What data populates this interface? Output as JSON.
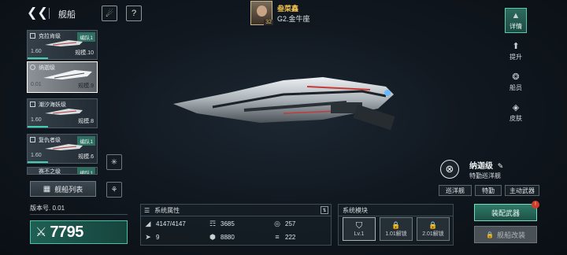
{
  "header": {
    "back_icon": "chevron-left-icon",
    "title": "舰船",
    "icon1": "planet-icon",
    "icon2": "help-icon"
  },
  "player": {
    "name": "叁菜鑫",
    "level": "32",
    "zone": "G2.金牛座"
  },
  "ships": [
    {
      "name": "克拉肯级",
      "fleet": "编队1",
      "value": "1.60",
      "scale": "规模.10",
      "progress": 0.3
    },
    {
      "name": "纳迦级",
      "fleet": "",
      "value": "0.01",
      "scale": "规模.9",
      "progress": 0.0,
      "selected": true
    },
    {
      "name": "潮汐海妖级",
      "fleet": "编队1",
      "value": "1.60",
      "scale": "规模.8",
      "progress": 0.3
    },
    {
      "name": "复仇者级",
      "fleet": "编队1",
      "value": "1.60",
      "scale": "规模.6",
      "progress": 0.3
    },
    {
      "name": "赛丕之级",
      "fleet": "编队1",
      "value": "",
      "scale": "",
      "progress": 0.0
    }
  ],
  "ship_list_button": "舰船列表",
  "tabs": [
    {
      "label": "详情",
      "icon": "pyramid-icon",
      "active": true
    },
    {
      "label": "提升",
      "icon": "arrow-up-icon"
    },
    {
      "label": "船员",
      "icon": "crew-icon"
    },
    {
      "label": "皮肤",
      "icon": "skin-icon"
    }
  ],
  "ship_info": {
    "name": "纳迦级",
    "class": "特勤巡洋舰",
    "tags": [
      "巡洋舰",
      "特勤",
      "主动武器"
    ]
  },
  "version": "版本号. 0.01",
  "power": "7795",
  "attributes": {
    "title": "系统属性",
    "items": [
      "4147/4147",
      "3685",
      "257",
      "9",
      "8880",
      "222"
    ]
  },
  "modules": {
    "title": "系统模块",
    "slots": [
      "Lv.1",
      "1.01解锁",
      "2.01解锁"
    ]
  },
  "equip_button": "装配武器",
  "equip_badge": "!",
  "refit_button": "舰船改装",
  "colors": {
    "accent": "#3fd0b4",
    "player_name": "#f0c04e",
    "badge": "#d23a2a"
  }
}
